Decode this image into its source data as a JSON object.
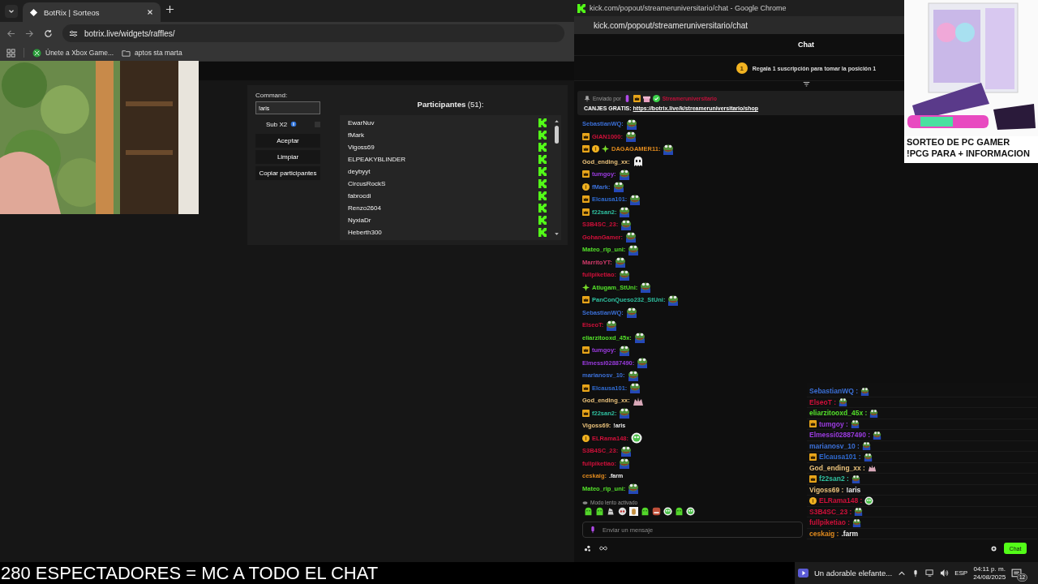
{
  "browser": {
    "tab": {
      "title": "BotRix | Sorteos"
    },
    "url": "botrix.live/widgets/raffles/",
    "bookmarks": [
      {
        "kind": "xbox",
        "label": "Únete a Xbox Game..."
      },
      {
        "kind": "folder",
        "label": "aptos sta marta"
      }
    ]
  },
  "raffle": {
    "command_label": "Command:",
    "command_value": "!aris",
    "sub_x2": {
      "label": "Sub X2",
      "checked": false
    },
    "buttons": [
      "Aceptar",
      "Limpiar",
      "Copiar participantes"
    ],
    "participants_title": "**Participantes** (51):",
    "participants": [
      "EwarNuv",
      "fMark",
      "Vigoss69",
      "ELPEAKYBLINDER",
      "deybyyt",
      "CircusRockS",
      "fabrocdi",
      "Renzo2604",
      "NyxiaDr",
      "Heberth300"
    ]
  },
  "popup": {
    "window_title": "kick.com/popout/streameruniversitario/chat - Google Chrome",
    "url": "kick.com/popout/streameruniversitario/chat",
    "chat_title": "Chat",
    "gift_rank": "1",
    "gift_text": "Regala 1 suscripción para tomar la posición 1",
    "pinned": {
      "label": "Enviado por",
      "badges": [
        {
          "kind": "mic"
        },
        {
          "kind": "sub"
        },
        {
          "kind": "gift"
        },
        {
          "kind": "verified"
        }
      ],
      "sender": "Streameruniversitario",
      "text": "CANJES GRATIS: ",
      "link": "https://botrix.live/k/streameruniversitario/shop"
    },
    "messages": [
      {
        "name": "SebastianWQ:",
        "color": "#3b6fd6",
        "emote": {
          "kind": "frog"
        }
      },
      {
        "name": "GIAN1000:",
        "color": "#d0103a",
        "badges": [
          {
            "kind": "sub"
          }
        ],
        "emote": {
          "kind": "frog"
        }
      },
      {
        "name": "DAGAGAMER11:",
        "color": "#e08a1e",
        "badges": [
          {
            "kind": "sub"
          },
          {
            "kind": "gifter"
          },
          {
            "kind": "vip"
          }
        ],
        "emote": {
          "kind": "frog"
        }
      },
      {
        "name": "God_ending_xx:",
        "color": "#e8c07a",
        "emote": {
          "kind": "ghost"
        }
      },
      {
        "name": "tumgoy:",
        "color": "#9b3be0",
        "badges": [
          {
            "kind": "sub"
          }
        ],
        "emote": {
          "kind": "frog"
        }
      },
      {
        "name": "fMark:",
        "color": "#3b6fd6",
        "badges": [
          {
            "kind": "gifter"
          }
        ],
        "emote": {
          "kind": "frog"
        }
      },
      {
        "name": "Elcausa101:",
        "color": "#2f6ad0",
        "badges": [
          {
            "kind": "sub"
          }
        ],
        "emote": {
          "kind": "frog"
        }
      },
      {
        "name": "f22san2:",
        "color": "#2fc0a0",
        "badges": [
          {
            "kind": "sub"
          }
        ],
        "emote": {
          "kind": "frog"
        }
      },
      {
        "name": "S3B4SC_23:",
        "color": "#d0103a",
        "emote": {
          "kind": "frog"
        }
      },
      {
        "name": "GohanGamer:",
        "color": "#d0103a",
        "emote": {
          "kind": "frog"
        }
      },
      {
        "name": "Mateo_rip_uni:",
        "color": "#53e02a",
        "emote": {
          "kind": "frog"
        }
      },
      {
        "name": "MarritoYT:",
        "color": "#d03a6a",
        "emote": {
          "kind": "frog"
        }
      },
      {
        "name": "fullpiketiao:",
        "color": "#d0103a",
        "emote": {
          "kind": "frog"
        }
      },
      {
        "name": "Atiugam_StUni:",
        "color": "#53e02a",
        "badges": [
          {
            "kind": "vip"
          }
        ],
        "emote": {
          "kind": "frog"
        }
      },
      {
        "name": "PanConQueso232_StUni:",
        "color": "#2fc0a0",
        "badges": [
          {
            "kind": "sub"
          }
        ],
        "emote": {
          "kind": "frog"
        }
      },
      {
        "name": "SebastianWQ:",
        "color": "#3b6fd6",
        "emote": {
          "kind": "frog"
        }
      },
      {
        "name": "ElseoT:",
        "color": "#d0103a",
        "emote": {
          "kind": "frog"
        }
      },
      {
        "name": "eliarzitooxd_45x:",
        "color": "#53e02a",
        "emote": {
          "kind": "frog"
        }
      },
      {
        "name": "tumgoy:",
        "color": "#9b3be0",
        "badges": [
          {
            "kind": "sub"
          }
        ],
        "emote": {
          "kind": "frog"
        }
      },
      {
        "name": "Elmessi02887490:",
        "color": "#9b3be0",
        "emote": {
          "kind": "frog"
        }
      },
      {
        "name": "marianosv_10:",
        "color": "#3b6fd6",
        "emote": {
          "kind": "frog"
        }
      },
      {
        "name": "Elcausa101:",
        "color": "#2f6ad0",
        "badges": [
          {
            "kind": "sub"
          }
        ],
        "emote": {
          "kind": "frog"
        }
      },
      {
        "name": "God_ending_xx:",
        "color": "#e8c07a",
        "emote": {
          "kind": "hands"
        }
      },
      {
        "name": "f22san2:",
        "color": "#2fc0a0",
        "badges": [
          {
            "kind": "sub"
          }
        ],
        "emote": {
          "kind": "frog"
        }
      },
      {
        "name": "Vigoss69:",
        "color": "#e8c07a",
        "text": "!aris"
      },
      {
        "name": "ELRama148:",
        "color": "#d0103a",
        "badges": [
          {
            "kind": "gifter"
          }
        ],
        "emote": {
          "kind": "alien"
        }
      },
      {
        "name": "S3B4SC_23:",
        "color": "#d0103a",
        "emote": {
          "kind": "frog"
        }
      },
      {
        "name": "fullpiketiao:",
        "color": "#d0103a",
        "emote": {
          "kind": "frog"
        }
      },
      {
        "name": "ceskaig:",
        "color": "#e08a1e",
        "text": ".farm"
      },
      {
        "name": "Mateo_rip_uni:",
        "color": "#53e02a",
        "emote": {
          "kind": "frog"
        }
      }
    ],
    "slow_mode": "Modo lento activado",
    "emotes": [
      {
        "kind": "blob"
      },
      {
        "kind": "blob"
      },
      {
        "kind": "hat"
      },
      {
        "kind": "skull"
      },
      {
        "kind": "box"
      },
      {
        "kind": "blob"
      },
      {
        "kind": "face"
      },
      {
        "kind": "alien"
      },
      {
        "kind": "blob"
      },
      {
        "kind": "alien"
      }
    ],
    "placeholder": "Enviar un mensaje",
    "send_button": "Chat"
  },
  "overlay_chat": {
    "messages": [
      {
        "name": "SebastianWQ :",
        "color": "#3b6fd6",
        "emote": {
          "kind": "frog"
        }
      },
      {
        "name": "ElseoT :",
        "color": "#d0103a",
        "emote": {
          "kind": "frog"
        }
      },
      {
        "name": "eliarzitooxd_45x :",
        "color": "#53e02a",
        "emote": {
          "kind": "frog"
        }
      },
      {
        "name": "tumgoy :",
        "color": "#9b3be0",
        "badges": [
          {
            "kind": "sub"
          }
        ],
        "emote": {
          "kind": "frog"
        }
      },
      {
        "name": "Elmessi02887490 :",
        "color": "#9b3be0",
        "emote": {
          "kind": "frog"
        }
      },
      {
        "name": "marianosv_10 :",
        "color": "#3b6fd6",
        "emote": {
          "kind": "frog"
        }
      },
      {
        "name": "Elcausa101 :",
        "color": "#2f6ad0",
        "badges": [
          {
            "kind": "sub"
          }
        ],
        "emote": {
          "kind": "frog"
        }
      },
      {
        "name": "God_ending_xx :",
        "color": "#e8c07a",
        "emote": {
          "kind": "hands"
        }
      },
      {
        "name": "f22san2 :",
        "color": "#2fc0a0",
        "badges": [
          {
            "kind": "sub"
          }
        ],
        "emote": {
          "kind": "frog"
        }
      },
      {
        "name": "Vigoss69 :",
        "color": "#e8c07a",
        "text": "!aris"
      },
      {
        "name": "ELRama148 :",
        "color": "#d0103a",
        "badges": [
          {
            "kind": "gifter"
          }
        ],
        "emote": {
          "kind": "alien"
        }
      },
      {
        "name": "S3B4SC_23 :",
        "color": "#d0103a",
        "emote": {
          "kind": "frog"
        }
      },
      {
        "name": "fullpiketiao :",
        "color": "#d0103a",
        "emote": {
          "kind": "frog"
        }
      },
      {
        "name": "ceskaig :",
        "color": "#e08a1e",
        "text": ".farm"
      }
    ]
  },
  "ad": {
    "lines": [
      "SORTEO DE PC GAMER",
      "!PCG PARA + INFORMACION"
    ]
  },
  "caption": "280 ESPECTADORES = MC A TODO EL CHAT",
  "taskbar": {
    "media": "Un adorable elefante...",
    "language": "ESP",
    "time": "04:11 p. m.",
    "date": "24/08/2025",
    "notifications": "12"
  }
}
